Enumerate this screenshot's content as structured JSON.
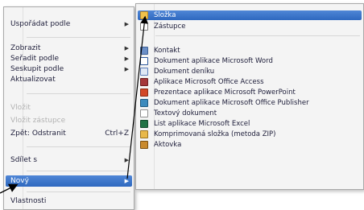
{
  "context_menu": {
    "items": [
      {
        "label": "Uspořádat podle",
        "submenu": true
      },
      {
        "label": "Zobrazit",
        "submenu": true
      },
      {
        "label": "Seřadit podle",
        "submenu": true
      },
      {
        "label": "Seskupit podle",
        "submenu": true
      },
      {
        "label": "Aktualizovat"
      },
      {
        "label": "Vložit",
        "disabled": true
      },
      {
        "label": "Vložit zástupce",
        "disabled": true
      },
      {
        "label": "Zpět: Odstranit",
        "shortcut": "Ctrl+Z"
      },
      {
        "label": "Sdílet s",
        "submenu": true
      },
      {
        "label": "Nový",
        "submenu": true,
        "active": true
      },
      {
        "label": "Vlastnosti"
      }
    ]
  },
  "new_submenu": {
    "items": [
      {
        "label": "Složka",
        "icon": "folder-icon",
        "highlight": true
      },
      {
        "label": "Zástupce",
        "icon": "shortcut-icon"
      },
      {
        "label": "Kontakt",
        "icon": "contact-icon"
      },
      {
        "label": "Dokument aplikace Microsoft Word",
        "icon": "word-document-icon"
      },
      {
        "label": "Dokument deníku",
        "icon": "journal-icon"
      },
      {
        "label": "Aplikace Microsoft Office Access",
        "icon": "access-icon"
      },
      {
        "label": "Prezentace aplikace Microsoft PowerPoint",
        "icon": "powerpoint-icon"
      },
      {
        "label": "Dokument aplikace Microsoft Office Publisher",
        "icon": "publisher-icon"
      },
      {
        "label": "Textový dokument",
        "icon": "text-document-icon"
      },
      {
        "label": "List aplikace Microsoft Excel",
        "icon": "excel-icon"
      },
      {
        "label": "Komprimovaná složka (metoda ZIP)",
        "icon": "zip-folder-icon"
      },
      {
        "label": "Aktovka",
        "icon": "briefcase-icon"
      }
    ]
  },
  "colors": {
    "menu_bg": "#f4f4f4",
    "highlight": "#3a75cc",
    "disabled_text": "#b3b3b3",
    "text": "#1e1e3a"
  }
}
